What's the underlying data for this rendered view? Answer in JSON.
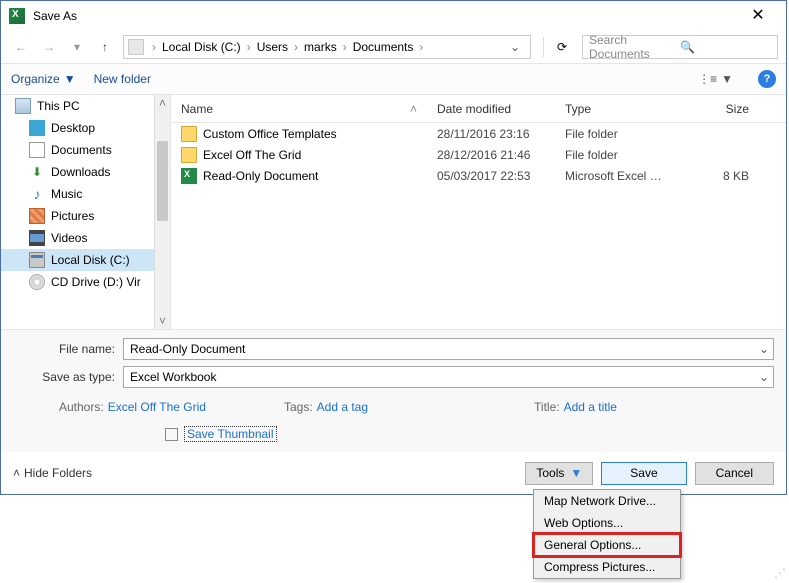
{
  "title": "Save As",
  "breadcrumb": [
    "Local Disk (C:)",
    "Users",
    "marks",
    "Documents"
  ],
  "search_placeholder": "Search Documents",
  "toolbar": {
    "organize": "Organize",
    "newfolder": "New folder"
  },
  "sidebar": [
    {
      "label": "This PC",
      "icon": "pc",
      "root": true
    },
    {
      "label": "Desktop",
      "icon": "desk"
    },
    {
      "label": "Documents",
      "icon": "doc"
    },
    {
      "label": "Downloads",
      "icon": "down"
    },
    {
      "label": "Music",
      "icon": "music"
    },
    {
      "label": "Pictures",
      "icon": "pic"
    },
    {
      "label": "Videos",
      "icon": "vid"
    },
    {
      "label": "Local Disk (C:)",
      "icon": "disk",
      "selected": true
    },
    {
      "label": "CD Drive (D:) Vir",
      "icon": "cd"
    }
  ],
  "columns": {
    "name": "Name",
    "date": "Date modified",
    "type": "Type",
    "size": "Size"
  },
  "files": [
    {
      "name": "Custom Office Templates",
      "date": "28/11/2016 23:16",
      "type": "File folder",
      "size": "",
      "icon": "folder"
    },
    {
      "name": "Excel Off The Grid",
      "date": "28/12/2016 21:46",
      "type": "File folder",
      "size": "",
      "icon": "folder"
    },
    {
      "name": "Read-Only Document",
      "date": "05/03/2017 22:53",
      "type": "Microsoft Excel W...",
      "size": "8 KB",
      "icon": "excel"
    }
  ],
  "form": {
    "filename_label": "File name:",
    "filename_value": "Read-Only Document",
    "savetype_label": "Save as type:",
    "savetype_value": "Excel Workbook",
    "authors_label": "Authors:",
    "authors_value": "Excel Off The Grid",
    "tags_label": "Tags:",
    "tags_value": "Add a tag",
    "title_label": "Title:",
    "title_value": "Add a title",
    "savethumb_label": "Save Thumbnail"
  },
  "footer": {
    "hidefolders": "Hide Folders",
    "tools": "Tools",
    "save": "Save",
    "cancel": "Cancel"
  },
  "popup": [
    "Map Network Drive...",
    "Web Options...",
    "General Options...",
    "Compress Pictures..."
  ],
  "popup_highlight_index": 2
}
